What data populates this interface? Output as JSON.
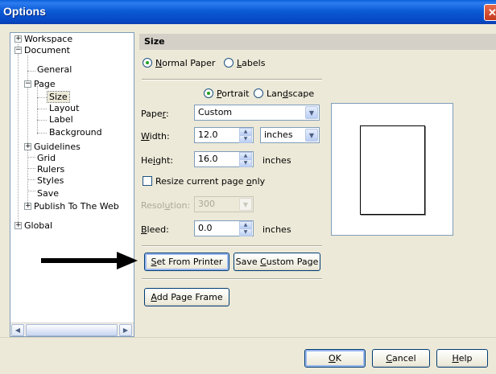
{
  "window": {
    "title": "Options",
    "close_symbol": "✕"
  },
  "tree": {
    "items": [
      {
        "label": "Workspace",
        "expander": "+"
      },
      {
        "label": "Document",
        "expander": "−"
      },
      {
        "label": "General"
      },
      {
        "label": "Page",
        "expander": "−"
      },
      {
        "label": "Size"
      },
      {
        "label": "Layout"
      },
      {
        "label": "Label"
      },
      {
        "label": "Background"
      },
      {
        "label": "Guidelines",
        "expander": "+"
      },
      {
        "label": "Grid"
      },
      {
        "label": "Rulers"
      },
      {
        "label": "Styles"
      },
      {
        "label": "Save"
      },
      {
        "label": "Publish To The Web",
        "expander": "+"
      },
      {
        "label": "Global",
        "expander": "+"
      }
    ],
    "scroll_left": "◀",
    "scroll_right": "▶"
  },
  "panel": {
    "header": "Size",
    "paper_type": {
      "normal_pre": "",
      "normal_key": "N",
      "normal_post": "ormal Paper",
      "labels_key": "L",
      "labels_post": "abels"
    },
    "orientation": {
      "portrait_key": "P",
      "portrait_post": "ortrait",
      "landscape_pre": "Lan",
      "landscape_key": "d",
      "landscape_post": "scape"
    },
    "paper": {
      "label_pre": "Pape",
      "label_key": "r",
      "label_post": ":",
      "value": "Custom"
    },
    "width": {
      "label_key": "W",
      "label_post": "idth:",
      "value": "12.0",
      "unit": "inches"
    },
    "height": {
      "label_pre": "He",
      "label_key": "i",
      "label_post": "ght:",
      "value": "16.0",
      "unit": "inches"
    },
    "resize": {
      "label_pre": "Resize current page ",
      "label_key": "o",
      "label_post": "nly"
    },
    "resolution": {
      "label_pre": "Resol",
      "label_key": "u",
      "label_post": "tion:",
      "value": "300"
    },
    "bleed": {
      "label_key": "B",
      "label_post": "leed:",
      "value": "0.0",
      "unit": "inches"
    },
    "buttons": {
      "set_from_printer_key": "S",
      "set_from_printer_post": "et From Printer",
      "save_custom_pre": "Save ",
      "save_custom_key": "C",
      "save_custom_post": "ustom Page",
      "add_frame_key": "A",
      "add_frame_post": "dd Page Frame"
    }
  },
  "dialog_buttons": {
    "ok_key": "O",
    "ok_post": "K",
    "cancel_key": "C",
    "cancel_post": "ancel",
    "help_key": "H",
    "help_post": "elp"
  },
  "icons": {
    "dropdown": "▼",
    "spin_up": "▲",
    "spin_down": "▼"
  }
}
